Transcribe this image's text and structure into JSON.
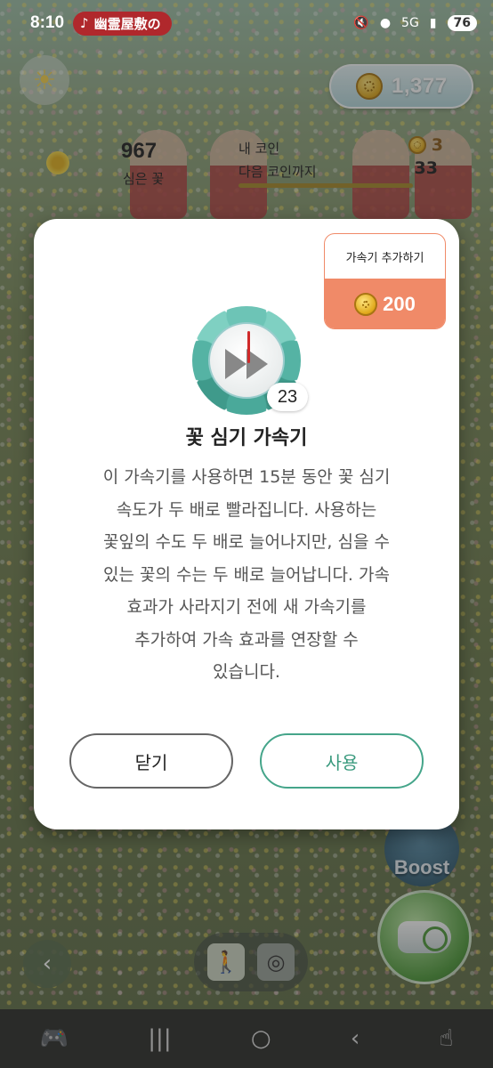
{
  "status_bar": {
    "time": "8:10",
    "now_playing": "幽霊屋敷の",
    "battery": "76",
    "network": "5G"
  },
  "hud": {
    "coin_balance": "1,377",
    "planted_count": "967",
    "planted_label": "심은 꽃",
    "my_coin_label": "내 코인",
    "my_coin_value": "3",
    "next_coin_label": "다음 코인까지",
    "next_coin_value": "33",
    "boost_label": "Boost"
  },
  "dialog": {
    "add_card_label": "가속기 추가하기",
    "add_card_price": "200",
    "timer_count": "23",
    "title": "꽃 심기 가속기",
    "description_lines": [
      "이 가속기를 사용하면 15분 동안 꽃 심기",
      "속도가 두 배로 빨라집니다. 사용하는",
      "꽃잎의 수도 두 배로 늘어나지만, 심을 수",
      "있는 꽃의 수는 두 배로 늘어납니다. 가속",
      "효과가 사라지기 전에 새 가속기를",
      "추가하여 가속 효과를 연장할 수",
      "있습니다."
    ],
    "close_label": "닫기",
    "use_label": "사용"
  },
  "colors": {
    "accent_teal": "#45a58a",
    "add_card_orange": "#f08a68"
  }
}
